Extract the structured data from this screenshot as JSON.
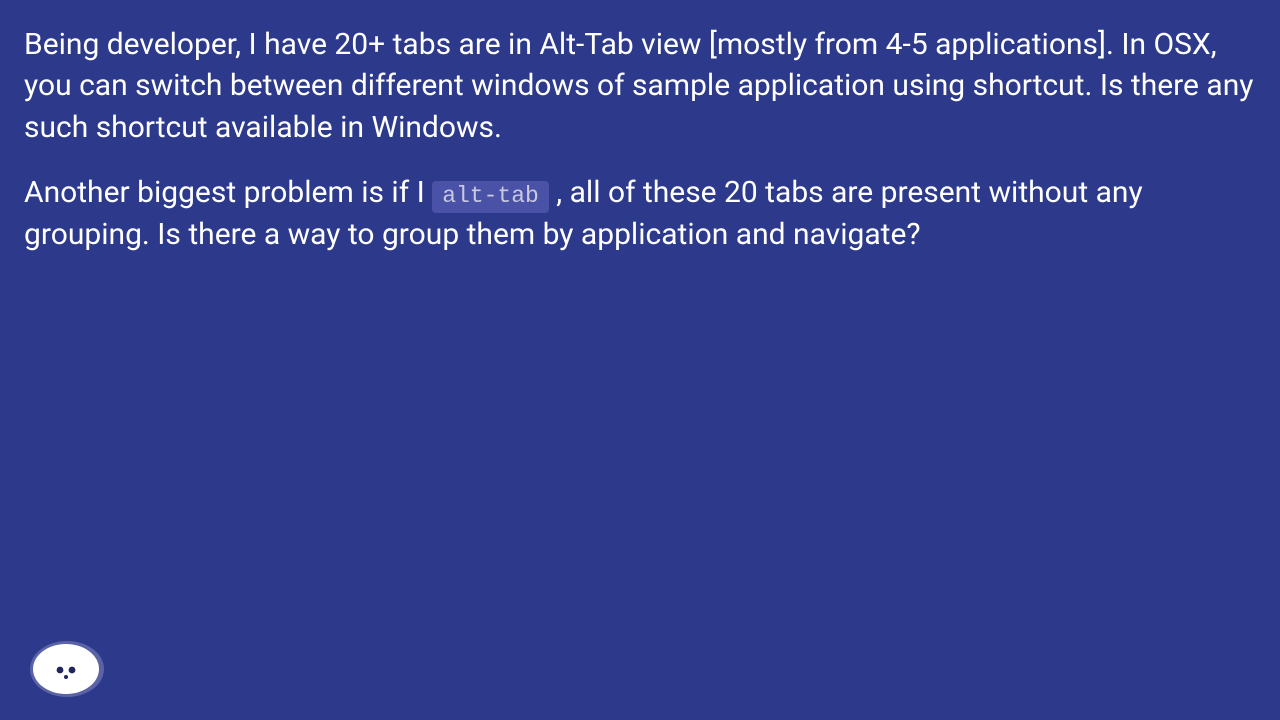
{
  "paragraph1": "Being developer, I have 20+ tabs are in Alt-Tab view [mostly from 4-5 applications]. In OSX, you can switch between different windows of sample application using shortcut. Is there any such shortcut available in Windows.",
  "paragraph2_pre": "Another biggest problem is if I ",
  "code_label": "alt-tab",
  "paragraph2_post": " , all of these 20 tabs are present without any grouping. Is there a way to group them by application and navigate?"
}
